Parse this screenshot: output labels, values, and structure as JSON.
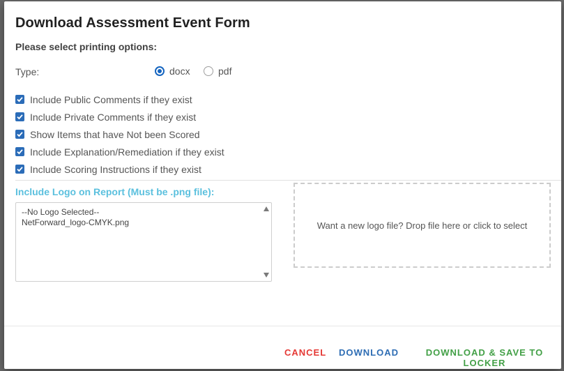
{
  "dialog": {
    "title": "Download Assessment Event Form",
    "subtitle": "Please select printing options:",
    "type_label": "Type:",
    "type_options": [
      {
        "label": "docx",
        "selected": true
      },
      {
        "label": "pdf",
        "selected": false
      }
    ],
    "checkboxes": [
      {
        "label": "Include Public Comments if they exist",
        "checked": true
      },
      {
        "label": "Include Private Comments if they exist",
        "checked": true
      },
      {
        "label": "Show Items that have Not been Scored",
        "checked": true
      },
      {
        "label": "Include Explanation/Remediation if they exist",
        "checked": true
      },
      {
        "label": "Include Scoring Instructions if they exist",
        "checked": true
      }
    ],
    "logo_label": "Include Logo on Report (Must be .png file):",
    "logo_options": [
      "--No Logo Selected--",
      "NetForward_logo-CMYK.png"
    ],
    "dropzone_text": "Want a new logo file? Drop file here or click to select",
    "buttons": {
      "cancel": "CANCEL",
      "download": "DOWNLOAD",
      "download_save": "DOWNLOAD & SAVE TO LOCKER"
    }
  },
  "colors": {
    "accent": "#1565c0",
    "checkbox": "#2b6cb8",
    "logo_label": "#5bc0de",
    "cancel": "#e53935",
    "download": "#2e6db4",
    "save": "#43a047"
  }
}
